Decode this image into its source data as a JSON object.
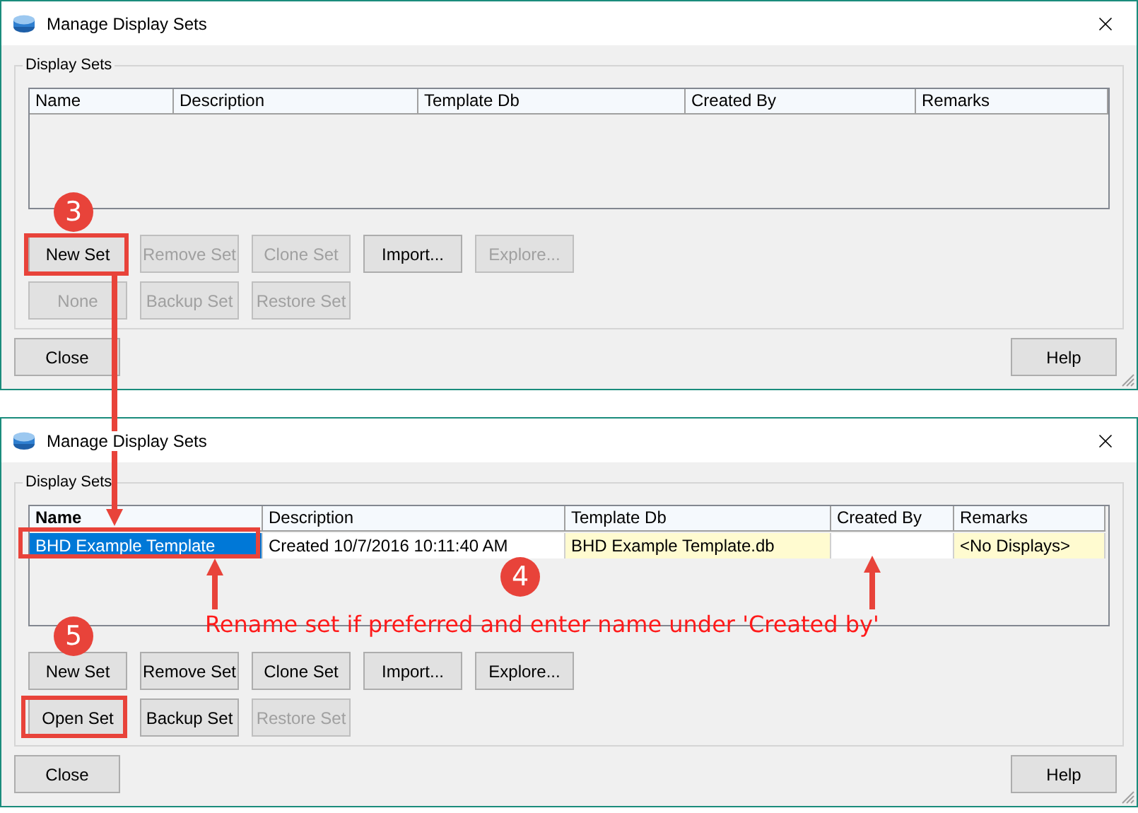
{
  "dialogs": [
    {
      "title": "Manage Display Sets",
      "group_label": "Display Sets",
      "columns": [
        {
          "label": "Name",
          "bold": false
        },
        {
          "label": "Description",
          "bold": false
        },
        {
          "label": "Template Db",
          "bold": false
        },
        {
          "label": "Created By",
          "bold": false
        },
        {
          "label": "Remarks",
          "bold": false
        }
      ],
      "button_rows": [
        [
          {
            "label": "New Set",
            "disabled": false
          },
          {
            "label": "Remove Set",
            "disabled": true
          },
          {
            "label": "Clone Set",
            "disabled": true
          },
          {
            "label": "Import...",
            "disabled": false
          },
          {
            "label": "Explore...",
            "disabled": true
          }
        ],
        [
          {
            "label": "None",
            "disabled": true
          },
          {
            "label": "Backup Set",
            "disabled": true
          },
          {
            "label": "Restore Set",
            "disabled": true
          }
        ]
      ],
      "footer": [
        {
          "label": "Close"
        },
        {
          "label": "Help"
        }
      ]
    },
    {
      "title": "Manage Display Sets",
      "group_label": "Display Sets",
      "columns": [
        {
          "label": "Name",
          "bold": true
        },
        {
          "label": "Description",
          "bold": false
        },
        {
          "label": "Template Db",
          "bold": false
        },
        {
          "label": "Created By",
          "bold": false
        },
        {
          "label": "Remarks",
          "bold": false
        }
      ],
      "rows": [
        {
          "selected": true,
          "cells": [
            {
              "text": "BHD Example Template"
            },
            {
              "text": "Created 10/7/2016 10:11:40 AM",
              "shaded": false
            },
            {
              "text": "BHD Example Template.db",
              "shaded": true
            },
            {
              "text": "",
              "shaded": false
            },
            {
              "text": "<No Displays>",
              "shaded": true
            }
          ]
        }
      ],
      "button_rows": [
        [
          {
            "label": "New Set",
            "disabled": false
          },
          {
            "label": "Remove Set",
            "disabled": false
          },
          {
            "label": "Clone Set",
            "disabled": false
          },
          {
            "label": "Import...",
            "disabled": false
          },
          {
            "label": "Explore...",
            "disabled": false
          }
        ],
        [
          {
            "label": "Open Set",
            "disabled": false
          },
          {
            "label": "Backup Set",
            "disabled": false
          },
          {
            "label": "Restore Set",
            "disabled": true
          }
        ]
      ],
      "footer": [
        {
          "label": "Close"
        },
        {
          "label": "Help"
        }
      ]
    }
  ],
  "annotations": {
    "steps": [
      "3",
      "4",
      "5"
    ],
    "note": "Rename set if preferred and enter name under 'Created by'"
  }
}
